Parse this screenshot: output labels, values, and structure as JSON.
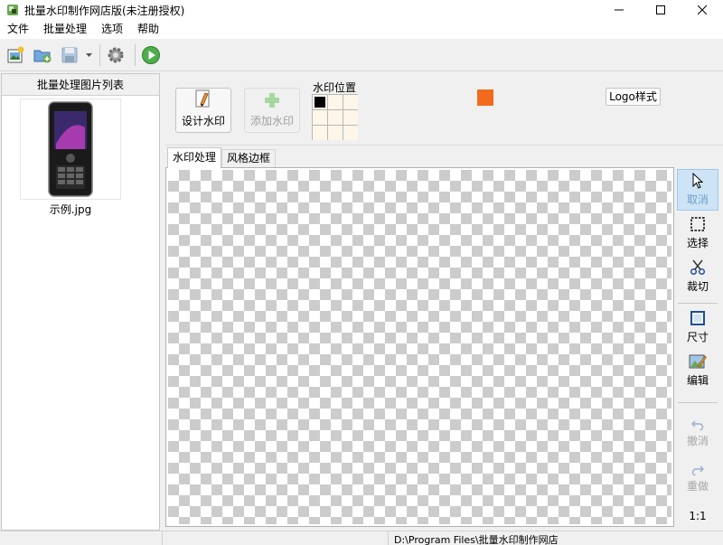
{
  "window": {
    "title": "批量水印制作网店版(未注册授权)"
  },
  "menu": [
    {
      "label": "文件"
    },
    {
      "label": "批量处理"
    },
    {
      "label": "选项"
    },
    {
      "label": "帮助"
    }
  ],
  "left_panel": {
    "header": "批量处理图片列表",
    "items": [
      {
        "name": "示例.jpg"
      }
    ]
  },
  "top_panel": {
    "design_button": "设计水印",
    "add_button": "添加水印",
    "position_label": "水印位置",
    "position_selected": "top-left",
    "watermark_color": "#f26a1b",
    "logo_button": "Logo样式"
  },
  "tabs": [
    {
      "label": "水印处理",
      "active": true
    },
    {
      "label": "风格边框",
      "active": false
    }
  ],
  "tools": [
    {
      "label": "取消",
      "icon": "cursor-icon",
      "state": "active"
    },
    {
      "label": "选择",
      "icon": "marquee-icon",
      "state": "normal"
    },
    {
      "label": "裁切",
      "icon": "scissors-icon",
      "state": "normal"
    },
    {
      "label": "尺寸",
      "icon": "resize-icon",
      "state": "normal"
    },
    {
      "label": "编辑",
      "icon": "edit-image-icon",
      "state": "normal"
    },
    {
      "label": "撤消",
      "icon": "undo-icon",
      "state": "disabled"
    },
    {
      "label": "重做",
      "icon": "redo-icon",
      "state": "disabled"
    }
  ],
  "zoom": "1:1",
  "status": {
    "path": "D:\\Program Files\\批量水印制作网店"
  },
  "colors": {
    "accent": "#f26a1b",
    "selected_tool_bg": "#cde4f7"
  }
}
